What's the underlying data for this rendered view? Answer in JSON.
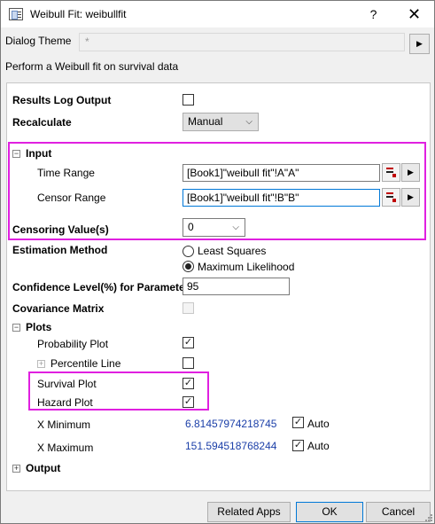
{
  "window": {
    "title": "Weibull Fit: weibullfit",
    "help_glyph": "?",
    "close_glyph": "✕"
  },
  "theme": {
    "label": "Dialog Theme",
    "value": "*"
  },
  "description": "Perform a Weibull fit on survival data",
  "results_log": {
    "label": "Results Log Output",
    "checked": false
  },
  "recalculate": {
    "label": "Recalculate",
    "value": "Manual"
  },
  "input": {
    "label": "Input",
    "time_range": {
      "label": "Time Range",
      "value": "[Book1]\"weibull fit\"!A\"A\""
    },
    "censor_range": {
      "label": "Censor Range",
      "value": "[Book1]\"weibull fit\"!B\"B\""
    },
    "censoring_value": {
      "label": "Censoring Value(s)",
      "value": "0"
    }
  },
  "estimation": {
    "label": "Estimation Method",
    "options": [
      "Least Squares",
      "Maximum Likelihood"
    ],
    "selected": "Maximum Likelihood"
  },
  "confidence": {
    "label": "Confidence Level(%) for Parameters",
    "value": "95"
  },
  "covariance": {
    "label": "Covariance Matrix",
    "checked": false,
    "disabled": true
  },
  "plots": {
    "label": "Plots",
    "probability_plot": {
      "label": "Probability Plot",
      "checked": true
    },
    "percentile_line": {
      "label": "Percentile Line",
      "checked": false
    },
    "survival_plot": {
      "label": "Survival Plot",
      "checked": true
    },
    "hazard_plot": {
      "label": "Hazard Plot",
      "checked": true
    },
    "x_minimum": {
      "label": "X Minimum",
      "value": "6.81457974218745",
      "auto_label": "Auto",
      "auto_checked": true
    },
    "x_maximum": {
      "label": "X Maximum",
      "value": "151.594518768244",
      "auto_label": "Auto",
      "auto_checked": true
    }
  },
  "output": {
    "label": "Output"
  },
  "buttons": {
    "related_apps": "Related Apps",
    "ok": "OK",
    "cancel": "Cancel"
  },
  "colors": {
    "highlight": "#e020e0",
    "value_text": "#1b3fa8",
    "focus_border": "#0078d7"
  },
  "icons": {
    "collapse_expanded": "−",
    "collapse_collapsed": "+",
    "checkmark": "✓",
    "chevron": "⌵",
    "play": "▶"
  }
}
